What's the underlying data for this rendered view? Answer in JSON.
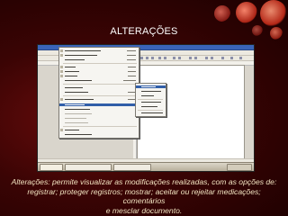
{
  "slide": {
    "title": "ALTERAÇÕES",
    "caption_lines": [
      "Alterações: permite visualizar as modificações realizadas, com as opções de:",
      "registrar; proteger registros; mostrar; aceitar ou rejeitar medicações; comentários",
      "e mesclar documento."
    ]
  },
  "screenshot": {
    "menu_highlight_item": "Alterações",
    "submenu_highlight_item": "Registrar",
    "taskbar_buttons": [
      "Iniciar",
      "Sem título 1 - BrOffice"
    ]
  },
  "colors": {
    "caption": "#f1e3c0",
    "title": "#ffffff",
    "background": "#3a0404",
    "highlight": "#315ea8"
  }
}
